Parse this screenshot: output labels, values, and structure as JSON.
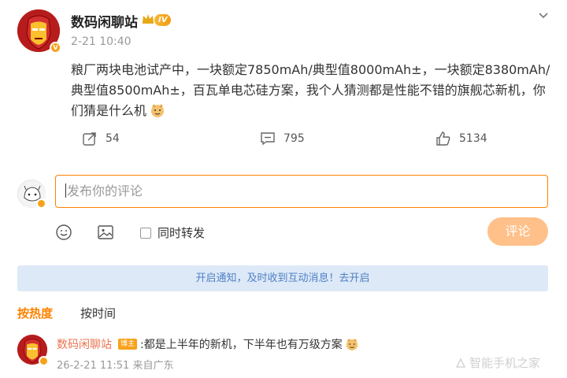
{
  "post": {
    "author": "数码闲聊站",
    "level": "IV",
    "verified_badge": "V",
    "time": "2-21 10:40",
    "content": "粮厂两块电池试产中，一块额定7850mAh/典型值8000mAh±，一块额定8380mAh/典型值8500mAh±，百瓦单电芯硅方案，我个人猜测都是性能不错的旗舰芯新机，你们猜是什么机",
    "emoji_icon": "doge-icon",
    "menu_icon": "chevron-down-icon"
  },
  "actions": {
    "repost_count": "54",
    "comment_count": "795",
    "like_count": "5134"
  },
  "compose": {
    "placeholder": "发布你的评论",
    "sync_label": "同时转发",
    "submit_label": "评论",
    "emoji_icon": "smile-icon",
    "image_icon": "image-icon"
  },
  "banner": {
    "text": "开启通知，及时收到互动消息！去开启"
  },
  "sort_tabs": {
    "hot": "按热度",
    "time": "按时间"
  },
  "comment": {
    "author": "数码闲聊站",
    "tag": "博主",
    "text": ":都是上半年的新机，下半年也有万级方案",
    "meta": "26-2-21 11:51 来自广东"
  },
  "watermark": {
    "text": "智能手机之家"
  },
  "colors": {
    "accent": "#ff8200",
    "author_link": "#eb7350",
    "banner_bg": "#dde9f7",
    "banner_text": "#5081c6",
    "submit_disabled": "#ffc089"
  }
}
